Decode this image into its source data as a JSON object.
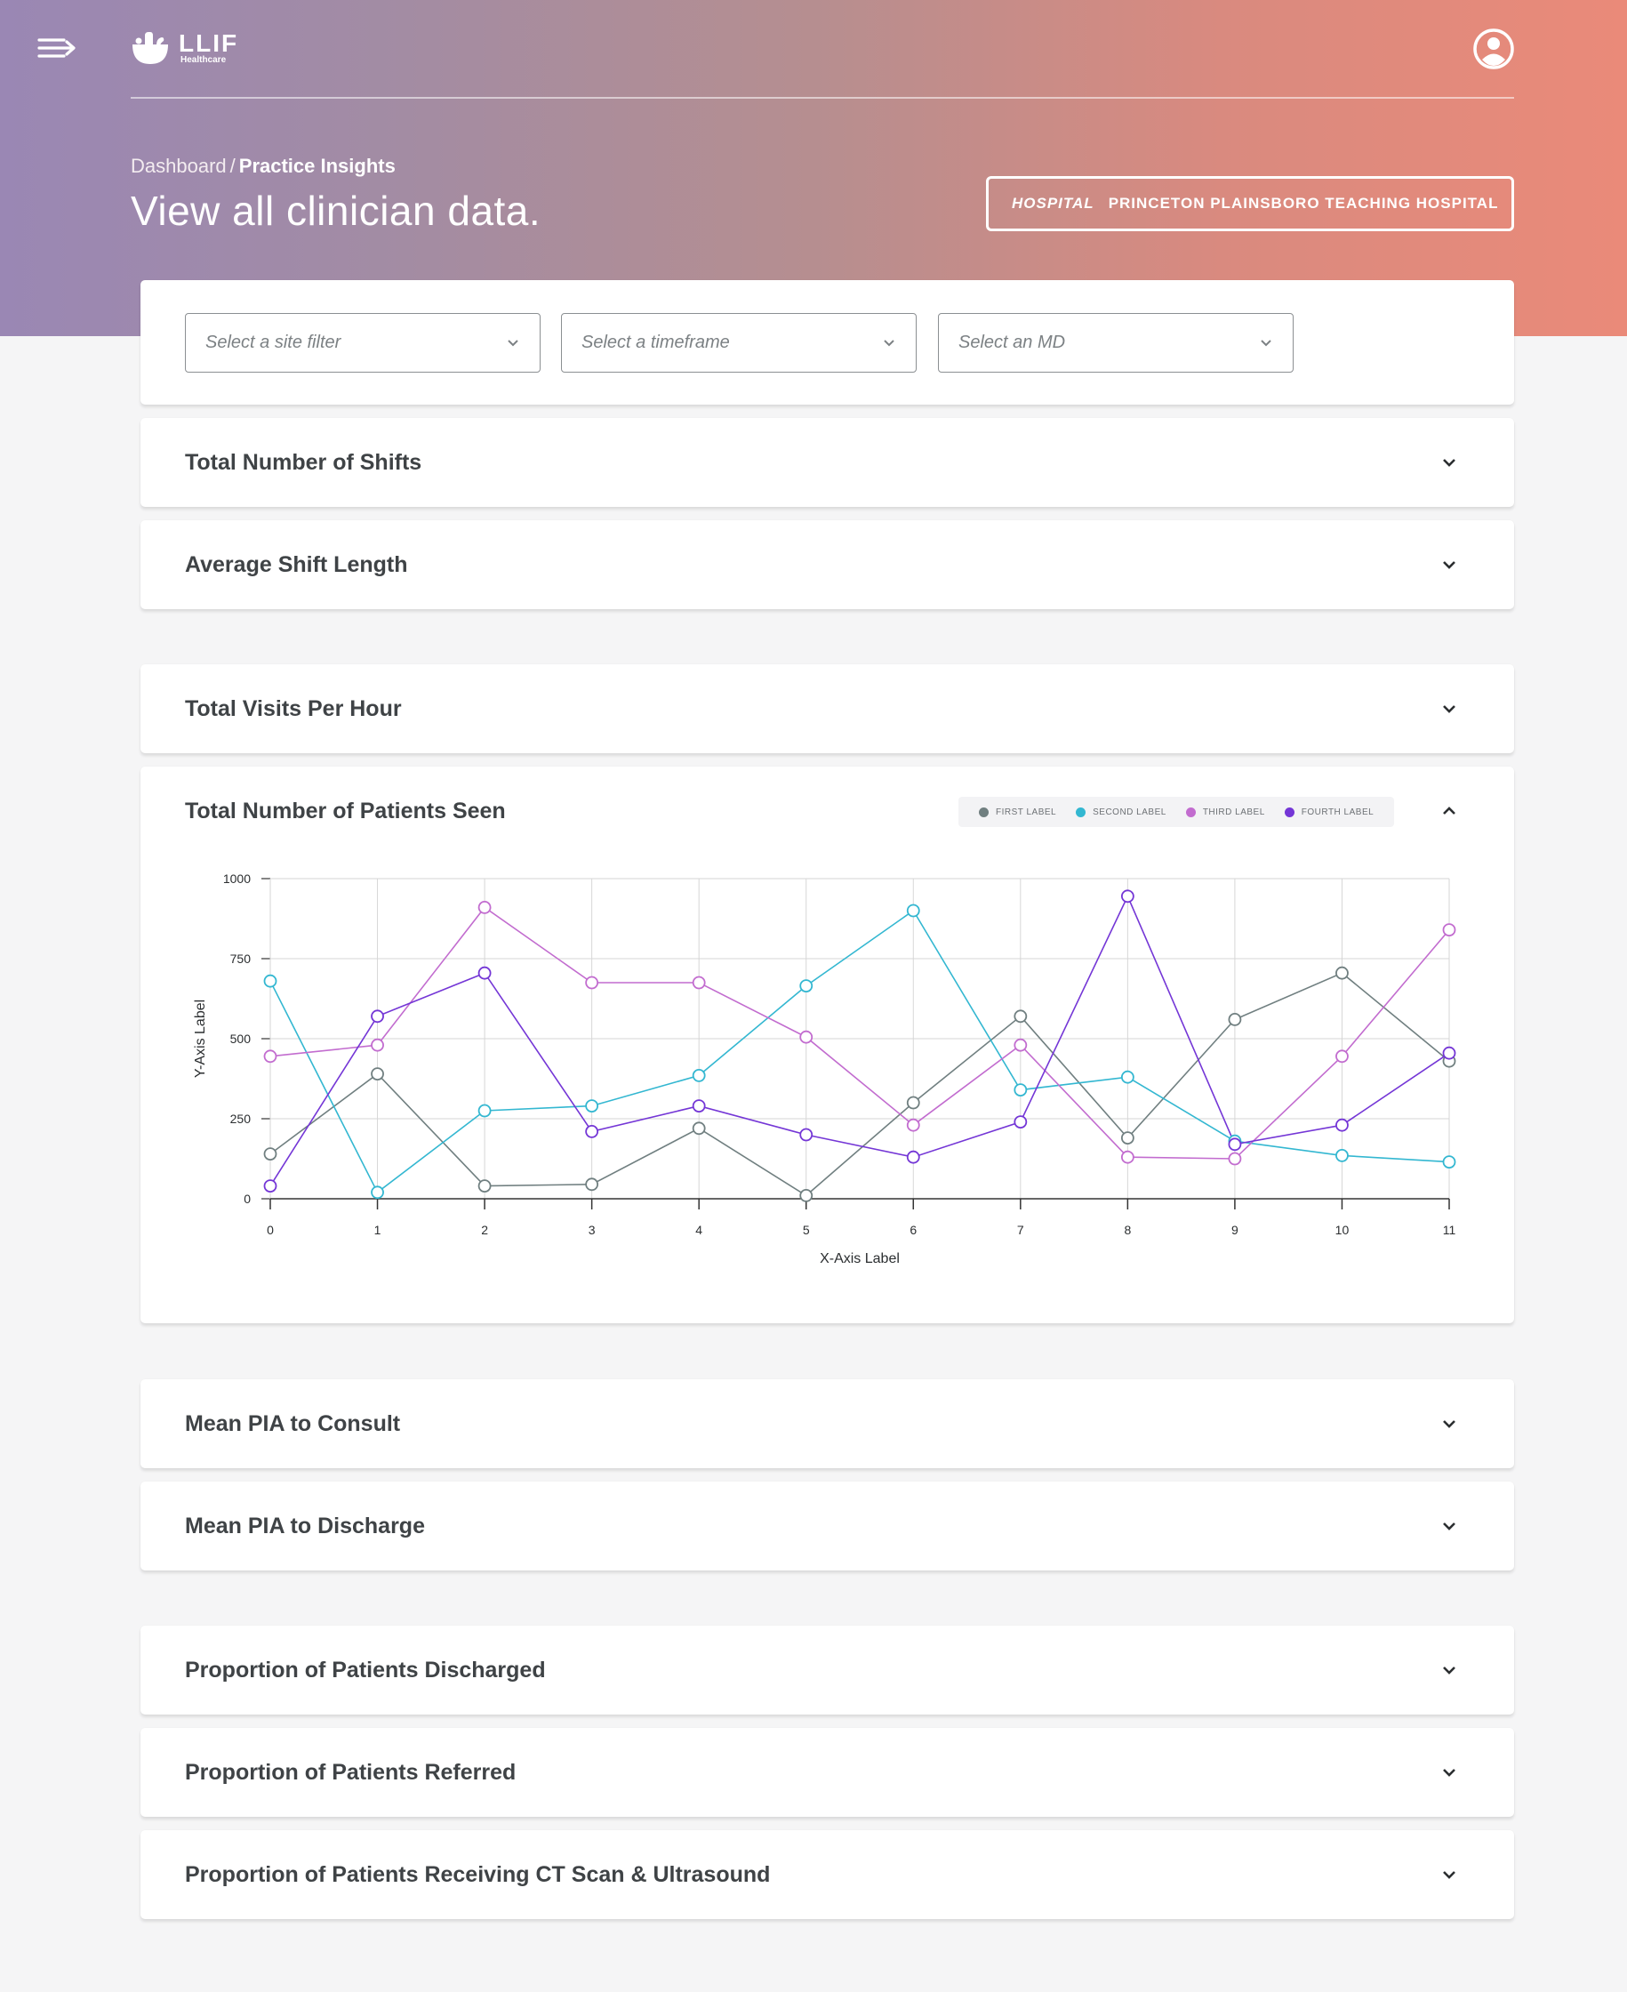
{
  "header": {
    "logo": {
      "name": "LLIF",
      "sub": "Healthcare"
    },
    "breadcrumb": {
      "parent": "Dashboard",
      "separator": "/",
      "current": "Practice Insights"
    },
    "title": "View all clinician data.",
    "hospital": {
      "key": "HOSPITAL",
      "value": "PRINCETON PLAINSBORO TEACHING HOSPITAL"
    }
  },
  "filters": {
    "site": "Select a site filter",
    "timeframe": "Select a timeframe",
    "md": "Select an MD"
  },
  "sections": {
    "shifts": "Total Number of Shifts",
    "avg_shift": "Average Shift Length",
    "visits": "Total Visits Per Hour",
    "patients": "Total Number of Patients Seen",
    "pia_consult": "Mean PIA to Consult",
    "pia_discharge": "Mean PIA to Discharge",
    "discharged": "Proportion of Patients Discharged",
    "referred": "Proportion of Patients Referred",
    "ct_us": "Proportion of Patients Receiving CT Scan & Ultrasound"
  },
  "colors": {
    "first": "#707f80",
    "second": "#33b7d1",
    "third": "#c26ccf",
    "fourth": "#7436d6"
  },
  "chart_data": {
    "type": "line",
    "xlabel": "X-Axis Label",
    "ylabel": "Y-Axis Label",
    "x": [
      0,
      1,
      2,
      3,
      4,
      5,
      6,
      7,
      8,
      9,
      10,
      11
    ],
    "yticks": [
      0,
      250,
      500,
      750,
      1000
    ],
    "ylim": [
      0,
      1000
    ],
    "grid": true,
    "legend_position": "top-right",
    "series": [
      {
        "name": "FIRST LABEL",
        "color": "#707f80",
        "values": [
          140,
          390,
          40,
          45,
          220,
          10,
          300,
          570,
          190,
          560,
          705,
          430
        ]
      },
      {
        "name": "SECOND LABEL",
        "color": "#33b7d1",
        "values": [
          680,
          20,
          275,
          290,
          385,
          665,
          900,
          340,
          380,
          180,
          135,
          115
        ]
      },
      {
        "name": "THIRD LABEL",
        "color": "#c26ccf",
        "values": [
          445,
          480,
          910,
          675,
          675,
          505,
          230,
          480,
          130,
          125,
          445,
          840
        ]
      },
      {
        "name": "FOURTH LABEL",
        "color": "#7436d6",
        "values": [
          40,
          570,
          705,
          210,
          290,
          200,
          130,
          240,
          945,
          170,
          230,
          455
        ]
      }
    ]
  }
}
